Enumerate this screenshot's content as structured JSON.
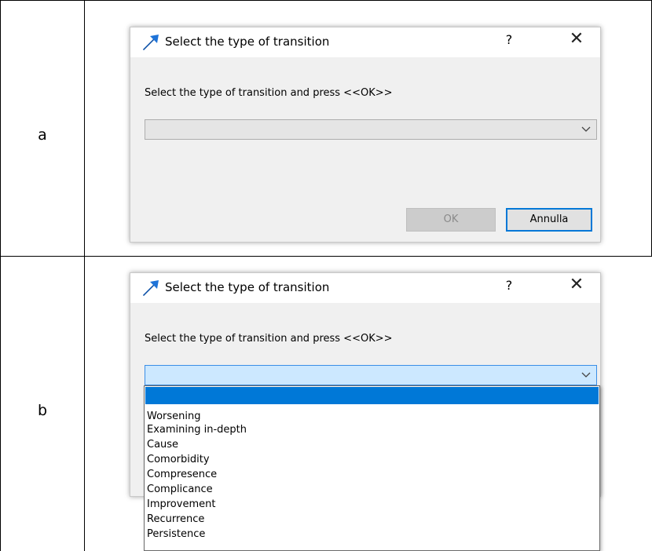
{
  "rows": [
    {
      "label": "a",
      "dialog": {
        "title": "Select the type of transition",
        "help_label": "?",
        "close_label": "✕",
        "prompt": "Select the type of transition and press <<OK>>",
        "combo_value": "",
        "ok_label": "OK",
        "cancel_label": "Annulla"
      }
    },
    {
      "label": "b",
      "dialog": {
        "title": "Select the type of transition",
        "help_label": "?",
        "close_label": "✕",
        "prompt": "Select the type of transition and press <<OK>>",
        "combo_value": "",
        "dropdown_options": [
          "",
          "Worsening",
          "Examining in-depth",
          "Cause",
          "Comorbidity",
          "Compresence",
          "Complicance",
          "Improvement",
          "Recurrence",
          "Persistence"
        ]
      }
    }
  ],
  "colors": {
    "selection": "#0078d7",
    "focused_combo": "#cce8ff",
    "dialog_bg": "#f0f0f0",
    "icon_blue": "#1e73d8"
  },
  "icons": {
    "app": "arrow-icon",
    "combo": "chevron-down-icon",
    "close": "close-icon"
  }
}
